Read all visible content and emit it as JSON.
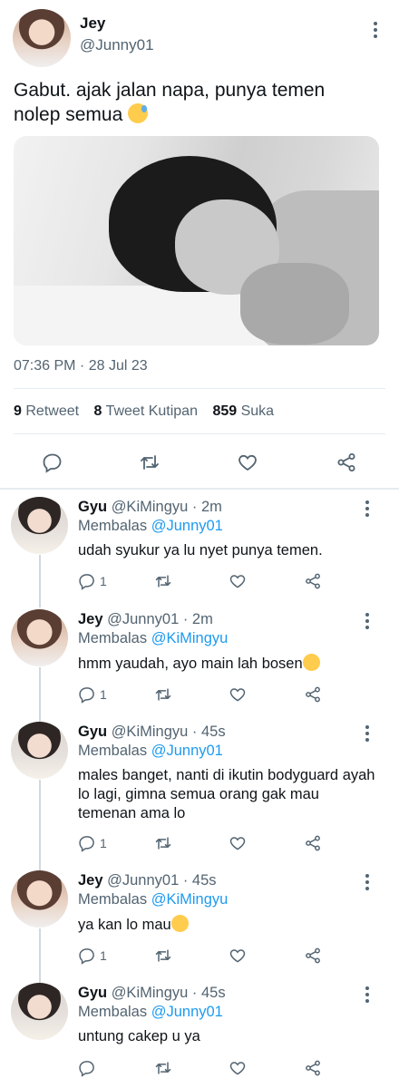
{
  "tweet": {
    "author_name": "Jey",
    "author_handle": "@Junny01",
    "text": "Gabut. ajak jalan napa, punya temen nolep semua",
    "emoji": "downcast-face-with-sweat",
    "timestamp": "07:36 PM · 28 Jul 23",
    "stats": {
      "retweets_count": "9",
      "retweets_label": "Retweet",
      "quotes_count": "8",
      "quotes_label": "Tweet Kutipan",
      "likes_count": "859",
      "likes_label": "Suka"
    },
    "actions": [
      "reply-icon",
      "retweet-icon",
      "like-icon",
      "share-icon"
    ]
  },
  "replies": [
    {
      "name": "Gyu",
      "handle": "@KiMingyu · 2m",
      "replying_label": "Membalas",
      "replying_to": "@Junny01",
      "text": "udah syukur ya lu nyet punya temen.",
      "reply_count": "1"
    },
    {
      "name": "Jey",
      "handle": "@Junny01 · 2m",
      "replying_label": "Membalas",
      "replying_to": "@KiMingyu",
      "text": "hmm yaudah, ayo main lah bosen",
      "emoji": "pensive-face",
      "reply_count": "1"
    },
    {
      "name": "Gyu",
      "handle": "@KiMingyu · 45s",
      "replying_label": "Membalas",
      "replying_to": "@Junny01",
      "text": "males banget, nanti di ikutin bodyguard ayah lo lagi, gimna semua orang gak mau temenan ama lo",
      "reply_count": "1"
    },
    {
      "name": "Jey",
      "handle": "@Junny01 · 45s",
      "replying_label": "Membalas",
      "replying_to": "@KiMingyu",
      "text": "ya kan lo mau",
      "emoji": "pensive-face",
      "reply_count": "1"
    },
    {
      "name": "Gyu",
      "handle": "@KiMingyu · 45s",
      "replying_label": "Membalas",
      "replying_to": "@Junny01",
      "text": "untung cakep u ya",
      "reply_count": ""
    }
  ],
  "colors": {
    "text_primary": "#0f1419",
    "text_secondary": "#536471",
    "link_blue": "#1d9bf0",
    "divider": "#e6ecf0"
  }
}
